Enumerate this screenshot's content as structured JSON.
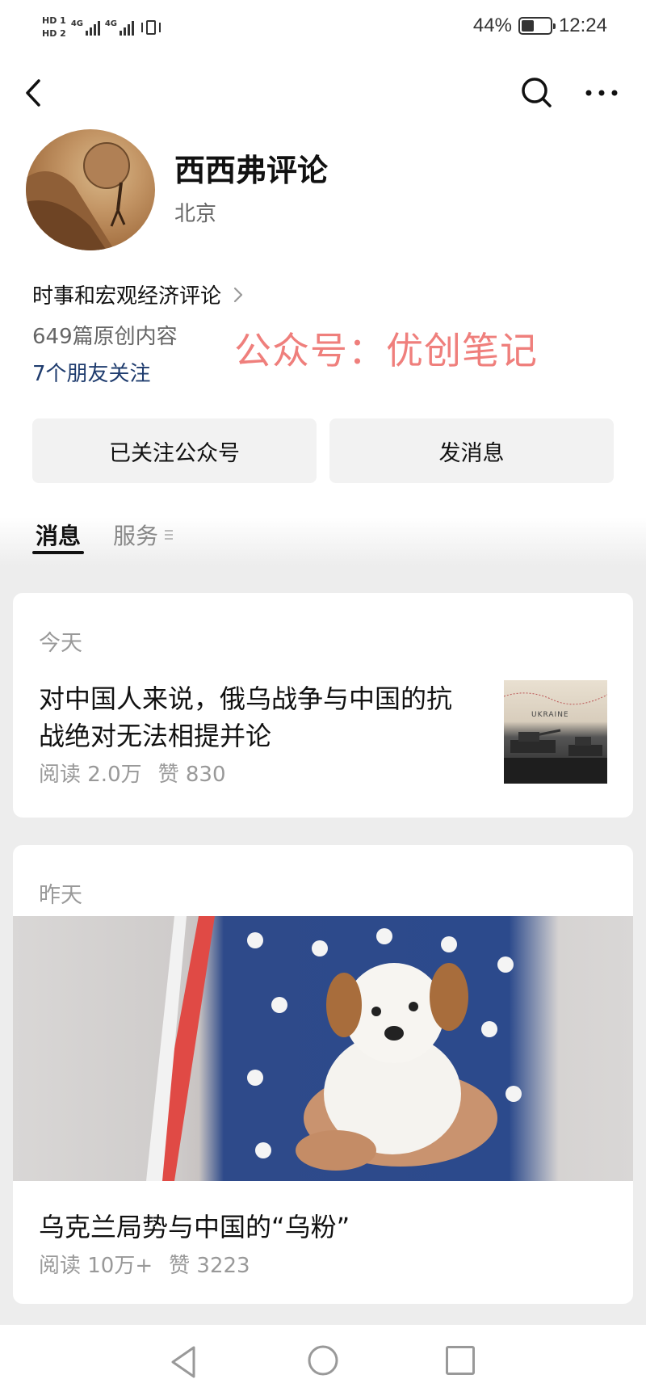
{
  "status_bar": {
    "hd1": "HD 1",
    "hd2": "HD 2",
    "net1": "4G",
    "net2": "4G",
    "battery_percent": "44%",
    "battery_level": 0.44,
    "time": "12:24"
  },
  "nav": {
    "back_icon": "chevron-left-icon",
    "search_icon": "search-icon",
    "more_icon": "more-dots-icon"
  },
  "profile": {
    "name": "西西弗评论",
    "location": "北京",
    "category": "时事和宏观经济评论",
    "stats": "649篇原创内容",
    "friends": "7个朋友关注",
    "watermark": "公众号：优创笔记"
  },
  "buttons": {
    "follow": "已关注公众号",
    "message": "发消息"
  },
  "tabs": {
    "messages": "消息",
    "services": "服务"
  },
  "articles": [
    {
      "date": "今天",
      "title": "对中国人来说，俄乌战争与中国的抗战绝对无法相提并论",
      "reads": "阅读 2.0万",
      "likes": "赞 830",
      "thumb_text": "UKRAINE"
    },
    {
      "date": "昨天",
      "title": "乌克兰局势与中国的“乌粉”",
      "reads": "阅读 10万+",
      "likes": "赞 3223"
    }
  ],
  "colors": {
    "watermark": "#ef7f7c",
    "friends_link": "#1f3c6e",
    "background": "#ededed"
  }
}
